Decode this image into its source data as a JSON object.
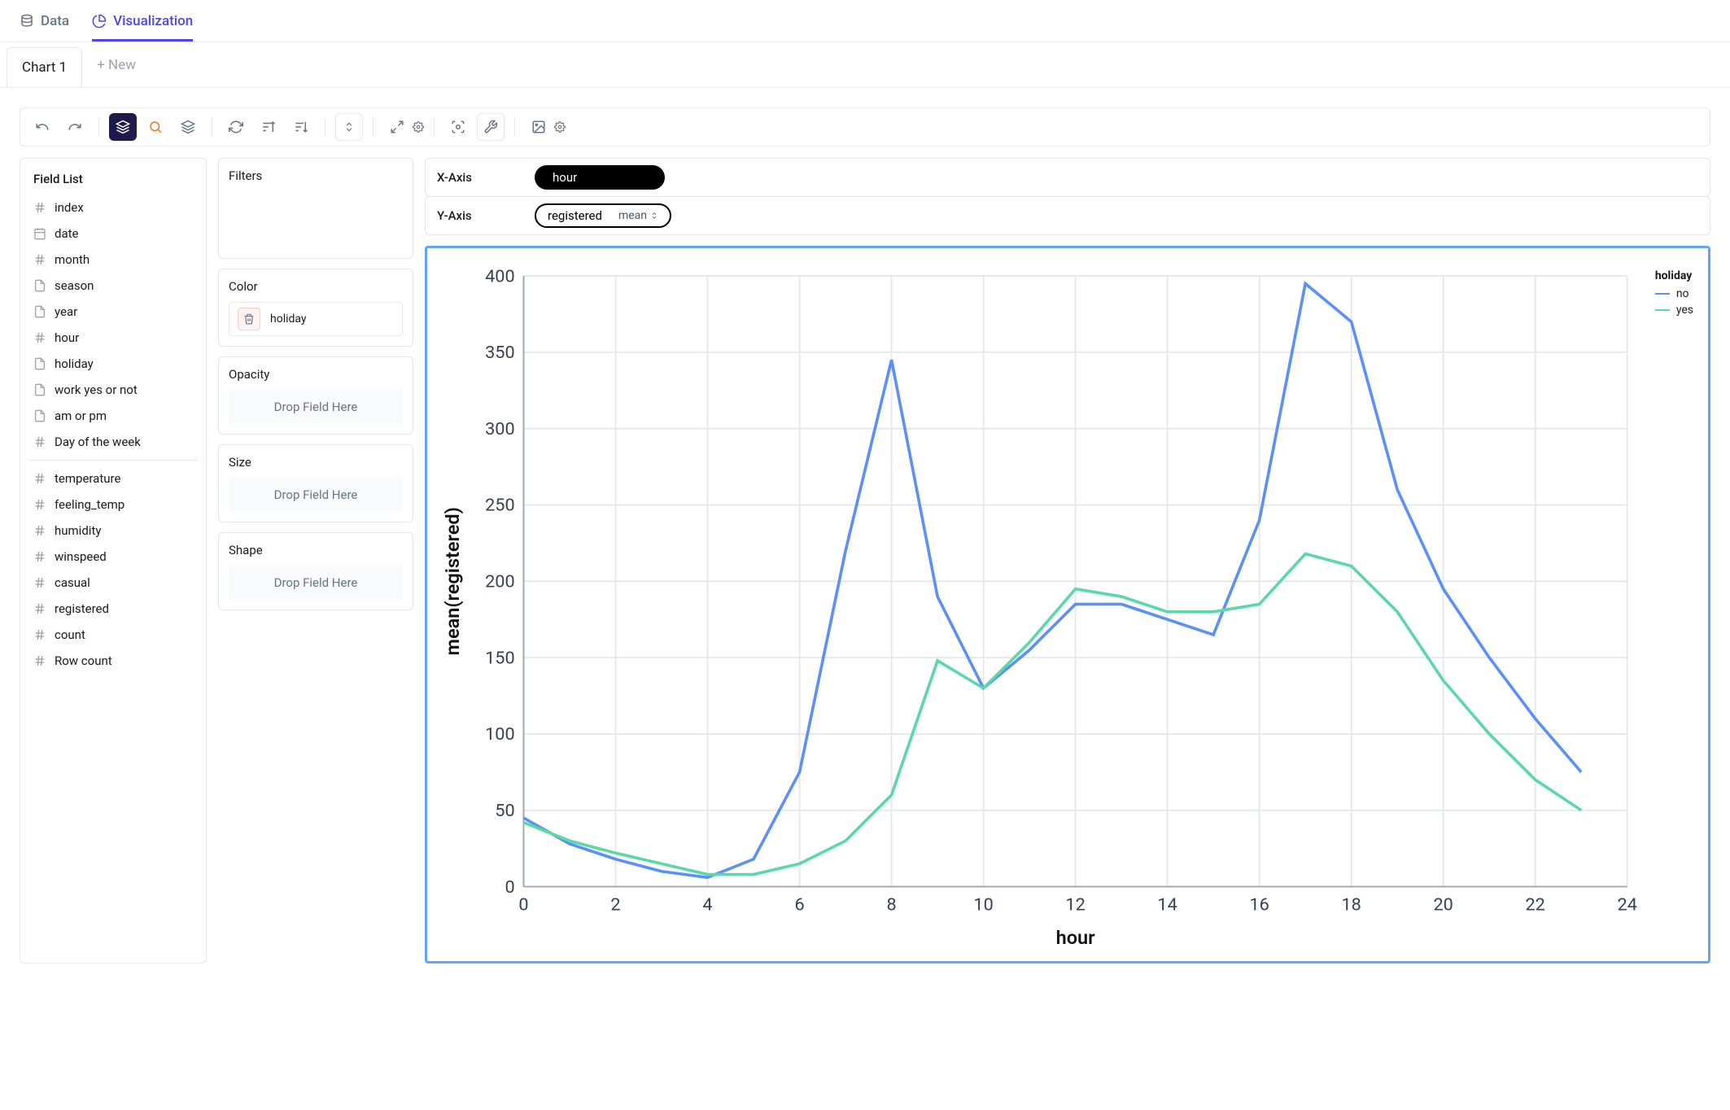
{
  "top_tabs": {
    "data": "Data",
    "visualization": "Visualization"
  },
  "chart_tabs": {
    "chart1": "Chart 1",
    "new": "+ New"
  },
  "field_list": {
    "title": "Field List",
    "groups": [
      [
        {
          "icon": "hash",
          "label": "index"
        },
        {
          "icon": "calendar",
          "label": "date"
        },
        {
          "icon": "hash",
          "label": "month"
        },
        {
          "icon": "doc",
          "label": "season"
        },
        {
          "icon": "doc",
          "label": "year"
        },
        {
          "icon": "hash",
          "label": "hour"
        },
        {
          "icon": "doc",
          "label": "holiday"
        },
        {
          "icon": "doc",
          "label": "work yes or not"
        },
        {
          "icon": "doc",
          "label": "am or pm"
        },
        {
          "icon": "hash",
          "label": "Day of the week"
        }
      ],
      [
        {
          "icon": "hash",
          "label": "temperature"
        },
        {
          "icon": "hash",
          "label": "feeling_temp"
        },
        {
          "icon": "hash",
          "label": "humidity"
        },
        {
          "icon": "hash",
          "label": "winspeed"
        },
        {
          "icon": "hash",
          "label": "casual"
        },
        {
          "icon": "hash",
          "label": "registered"
        },
        {
          "icon": "hash",
          "label": "count"
        },
        {
          "icon": "hash",
          "label": "Row count"
        }
      ]
    ]
  },
  "encodings": {
    "filters": {
      "title": "Filters"
    },
    "color": {
      "title": "Color",
      "value": "holiday"
    },
    "opacity": {
      "title": "Opacity",
      "placeholder": "Drop Field Here"
    },
    "size": {
      "title": "Size",
      "placeholder": "Drop Field Here"
    },
    "shape": {
      "title": "Shape",
      "placeholder": "Drop Field Here"
    }
  },
  "axes": {
    "x": {
      "label": "X-Axis",
      "field": "hour"
    },
    "y": {
      "label": "Y-Axis",
      "field": "registered",
      "agg": "mean"
    }
  },
  "legend": {
    "title": "holiday",
    "items": [
      {
        "label": "no",
        "color": "#5b8ff9"
      },
      {
        "label": "yes",
        "color": "#5ad8a6"
      }
    ]
  },
  "chart_data": {
    "type": "line",
    "title": "",
    "xlabel": "hour",
    "ylabel": "mean(registered)",
    "xlim": [
      0,
      24
    ],
    "ylim": [
      0,
      400
    ],
    "x_ticks": [
      0,
      2,
      4,
      6,
      8,
      10,
      12,
      14,
      16,
      18,
      20,
      22,
      24
    ],
    "y_ticks": [
      0,
      50,
      100,
      150,
      200,
      250,
      300,
      350,
      400
    ],
    "x": [
      0,
      1,
      2,
      3,
      4,
      5,
      6,
      7,
      8,
      9,
      10,
      11,
      12,
      13,
      14,
      15,
      16,
      17,
      18,
      19,
      20,
      21,
      22,
      23
    ],
    "series": [
      {
        "name": "no",
        "color": "#5b8ff9",
        "values": [
          45,
          28,
          18,
          10,
          6,
          18,
          75,
          220,
          345,
          190,
          130,
          155,
          185,
          185,
          175,
          165,
          240,
          395,
          370,
          260,
          195,
          150,
          110,
          75
        ]
      },
      {
        "name": "yes",
        "color": "#5ad8a6",
        "values": [
          42,
          30,
          22,
          15,
          8,
          8,
          15,
          30,
          60,
          148,
          130,
          160,
          195,
          190,
          180,
          180,
          185,
          218,
          210,
          180,
          135,
          100,
          70,
          50
        ]
      }
    ]
  }
}
